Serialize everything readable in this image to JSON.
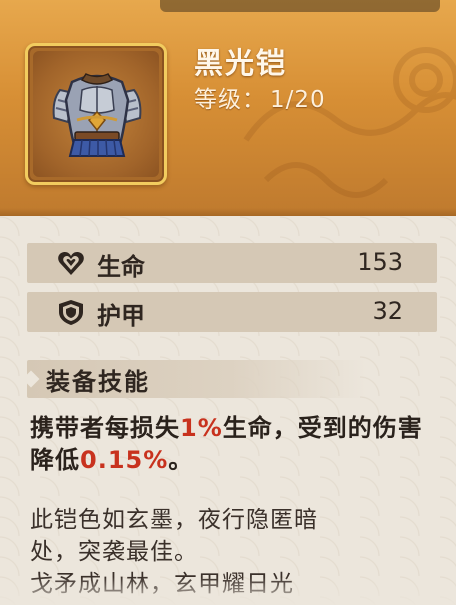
{
  "item": {
    "name": "黑光铠",
    "level_label": "等级：",
    "level_value": "1/20",
    "icon": "armor-chestplate-icon"
  },
  "stats": [
    {
      "icon": "heart-icon",
      "label": "生命",
      "value": "153"
    },
    {
      "icon": "shield-icon",
      "label": "护甲",
      "value": "32"
    }
  ],
  "skill": {
    "title": "装备技能",
    "desc_part1": "携带者每损失",
    "desc_highlight1": "1%",
    "desc_part2": "生命，受到的伤害降低",
    "desc_highlight2": "0.15%",
    "desc_part3": "。"
  },
  "lore": {
    "line1": "此铠色如玄墨，夜行隐匿暗",
    "line2": "处，突袭最佳。",
    "line3": "戈矛成山林，玄甲耀日光"
  },
  "colors": {
    "header": "#d78f35",
    "frame": "#f2cc5f",
    "stat_row": "#d5c8b5",
    "highlight": "#c8321e",
    "panel": "#ece6dc"
  }
}
